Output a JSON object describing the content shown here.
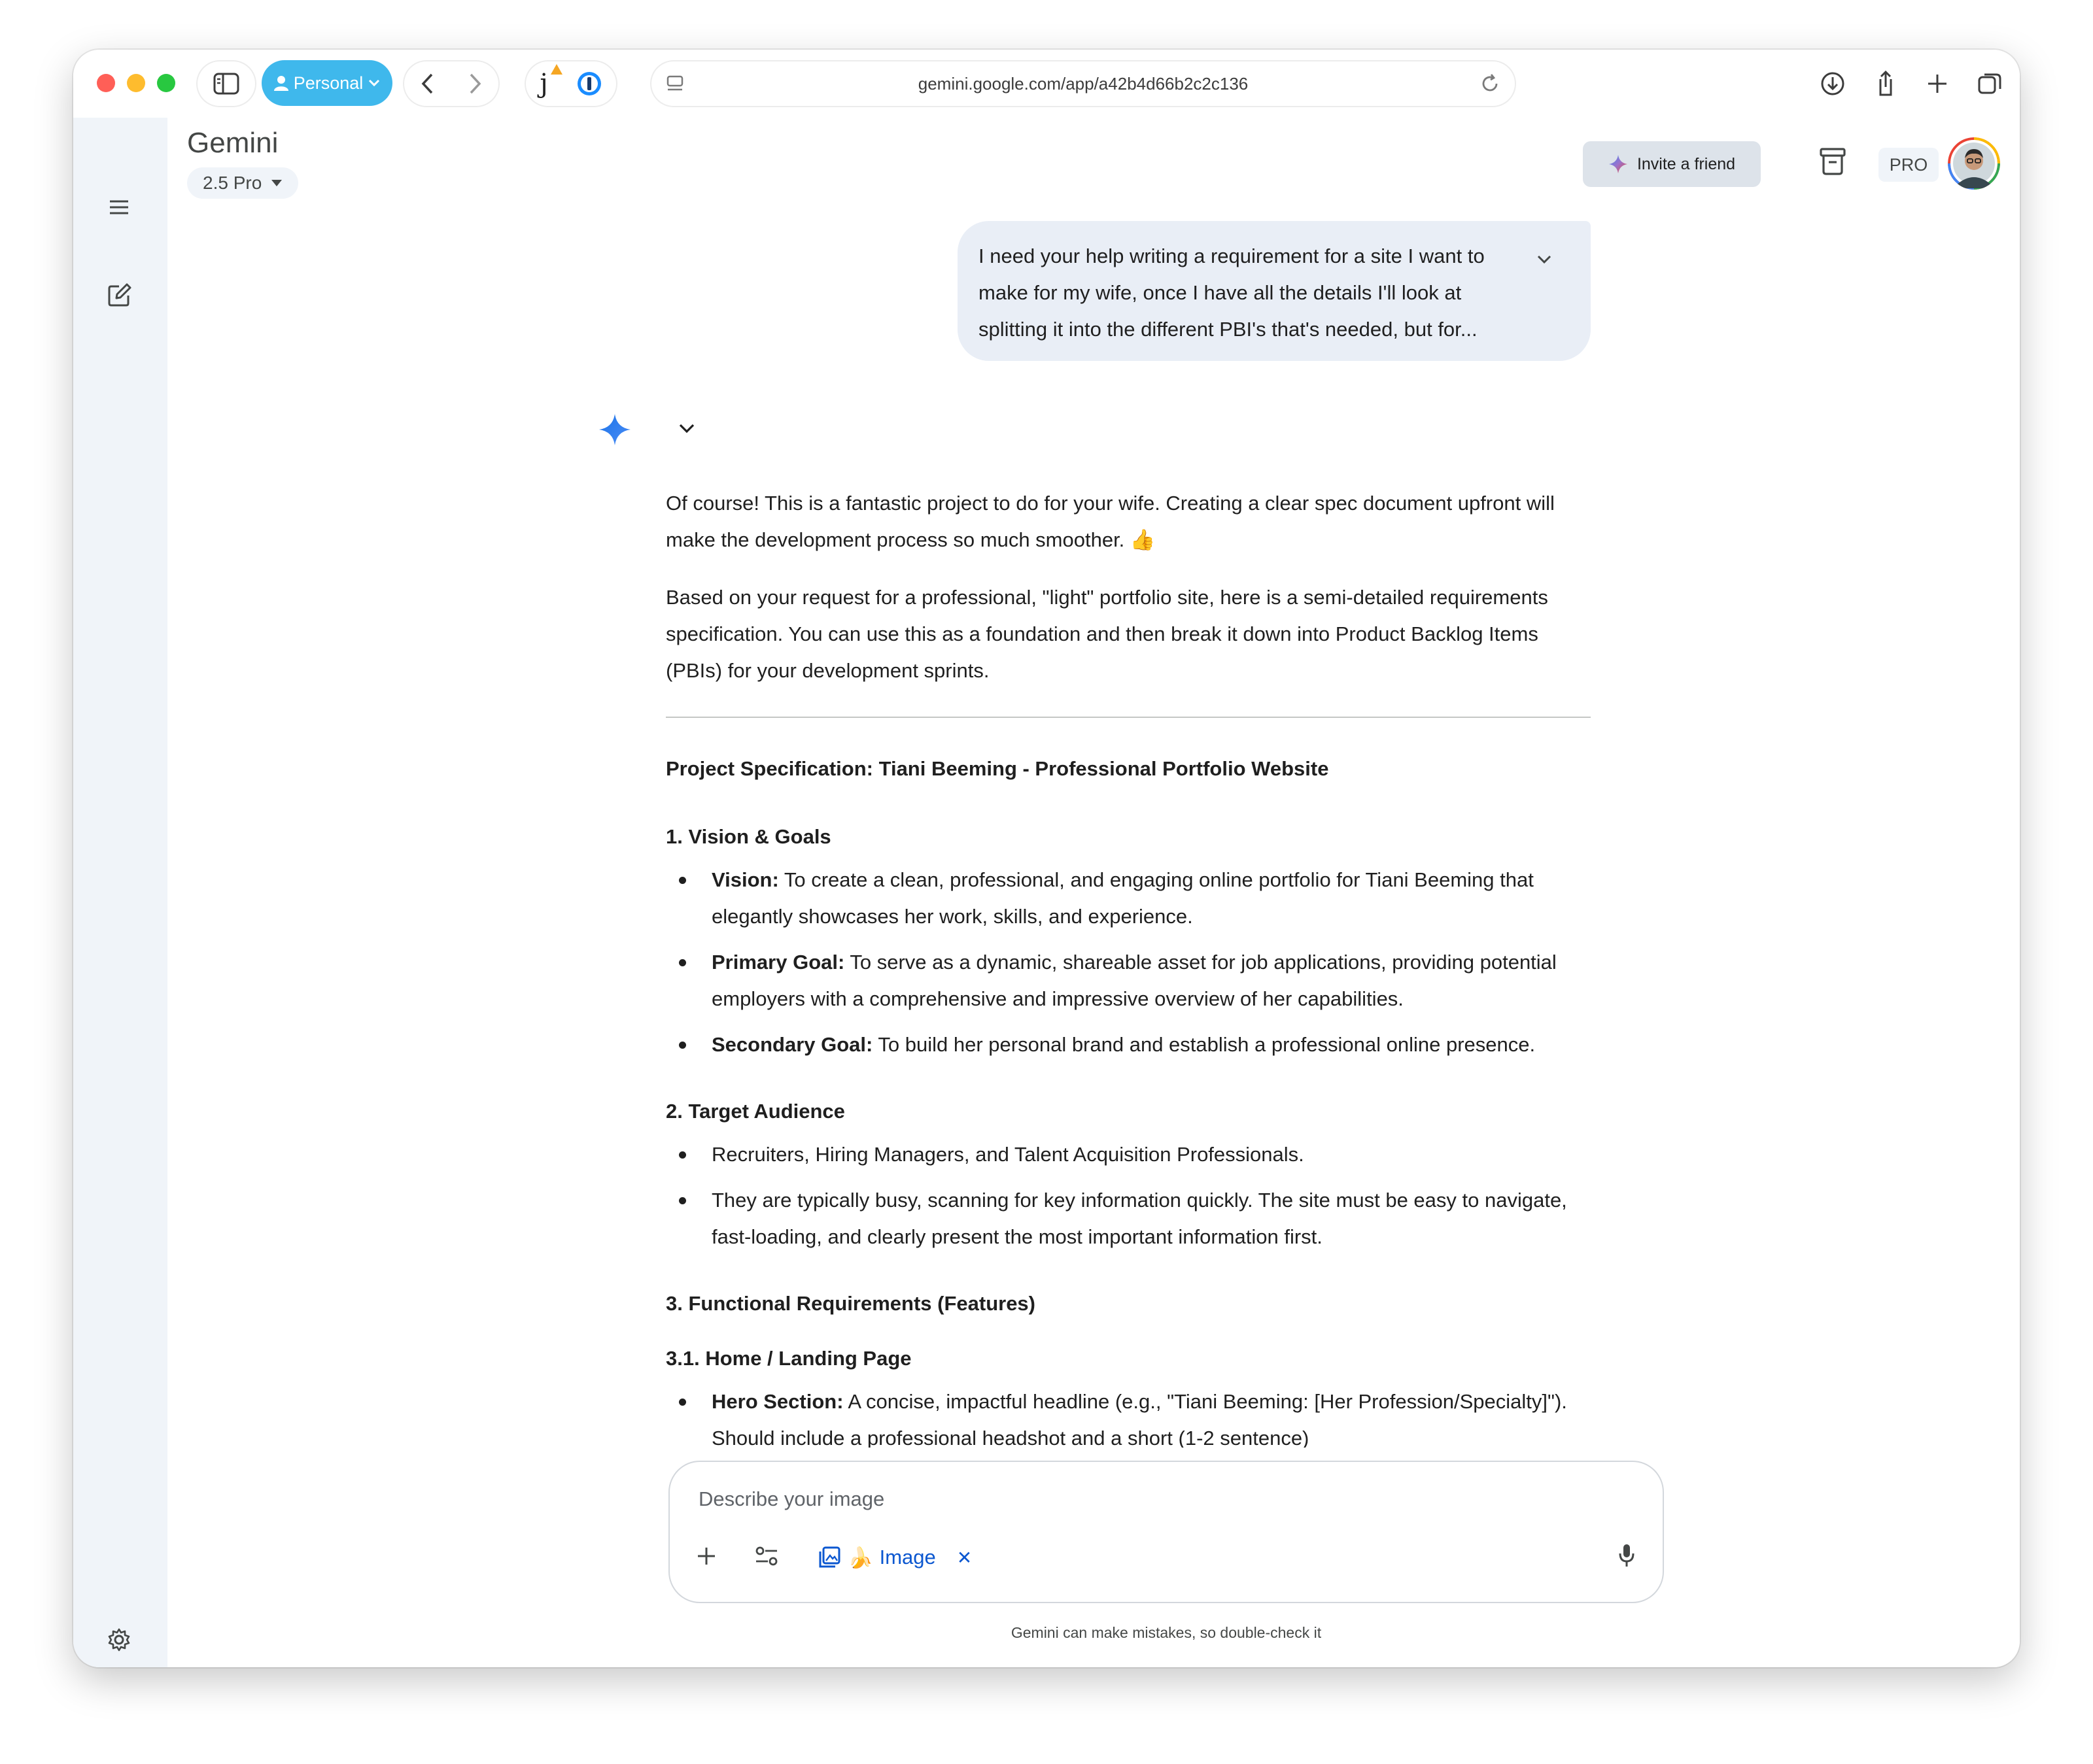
{
  "browser": {
    "profile_label": "Personal",
    "url": "gemini.google.com/app/a42b4d66b2c2c136",
    "extension_letter": "j"
  },
  "app": {
    "title": "Gemini",
    "model_label": "2.5 Pro",
    "invite_label": "Invite a friend",
    "pro_badge": "PRO"
  },
  "user_message": {
    "text": "I need your help writing a requirement for a site I want to make for my wife, once I have all the details I'll look at splitting it into the different PBI's that's needed, but for..."
  },
  "response": {
    "intro_1": "Of course! This is a fantastic project to do for your wife. Creating a clear spec document upfront will make the development process so much smoother. 👍",
    "intro_2": "Based on your request for a professional, \"light\" portfolio site, here is a semi-detailed requirements specification. You can use this as a foundation and then break it down into Product Backlog Items (PBIs) for your development sprints.",
    "spec_title": "Project Specification: Tiani Beeming - Professional Portfolio Website",
    "section_1": {
      "heading": "1. Vision & Goals",
      "items": [
        {
          "label": "Vision:",
          "text": " To create a clean, professional, and engaging online portfolio for Tiani Beeming that elegantly showcases her work, skills, and experience."
        },
        {
          "label": "Primary Goal:",
          "text": " To serve as a dynamic, shareable asset for job applications, providing potential employers with a comprehensive and impressive overview of her capabilities."
        },
        {
          "label": "Secondary Goal:",
          "text": " To build her personal brand and establish a professional online presence."
        }
      ]
    },
    "section_2": {
      "heading": "2. Target Audience",
      "items": [
        "Recruiters, Hiring Managers, and Talent Acquisition Professionals.",
        "They are typically busy, scanning for key information quickly. The site must be easy to navigate, fast-loading, and clearly present the most important information first."
      ]
    },
    "section_3": {
      "heading": "3. Functional Requirements (Features)",
      "sub_heading": "3.1. Home / Landing Page",
      "items": [
        {
          "label": "Hero Section:",
          "text": " A concise, impactful headline (e.g., \"Tiani Beeming: [Her Profession/Specialty]\"). Should include a professional headshot and a short (1-2 sentence)"
        }
      ]
    }
  },
  "composer": {
    "placeholder": "Describe your image",
    "image_chip_label": "Image",
    "image_chip_emoji": "🍌",
    "remove_symbol": "✕"
  },
  "disclaimer": "Gemini can make mistakes, so double-check it",
  "colors": {
    "accent_blue": "#0b57d0",
    "profile_pill": "#3fb8ec",
    "rail_bg": "#f0f4f9",
    "bubble_bg": "#e9eef6",
    "invite_bg": "#dde3ea"
  }
}
